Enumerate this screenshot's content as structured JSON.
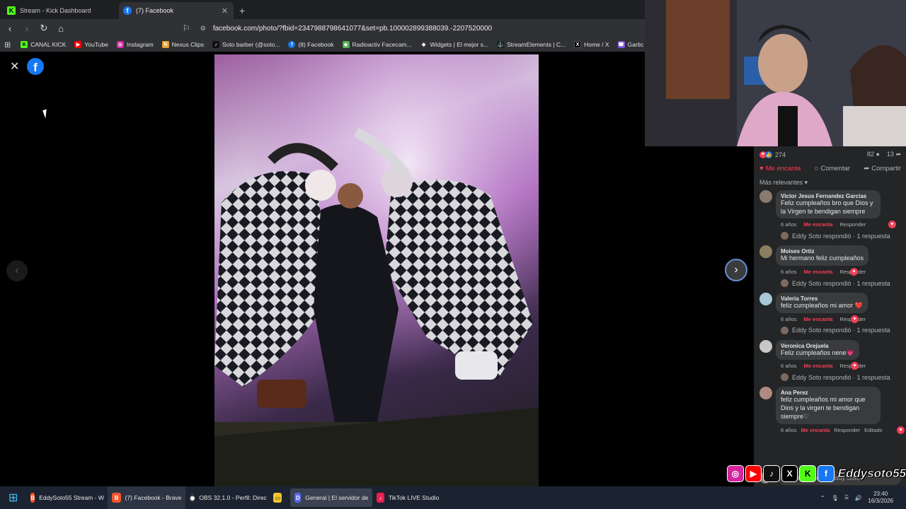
{
  "tabs": [
    {
      "title": "Stream - Kick Dashboard",
      "favicon": "K",
      "color": "#53fc18"
    },
    {
      "title": "(7) Facebook",
      "favicon": "f",
      "color": "#1877f2"
    }
  ],
  "new_tab": "+",
  "url": "facebook.com/photo/?fbid=2347988798641077&set=pb.100002899388039.-2207520000",
  "bookmarks": [
    {
      "label": "CANAL KICK",
      "icon": "K",
      "color": "#53fc18"
    },
    {
      "label": "YouTube",
      "icon": "▶",
      "color": "#ff0000"
    },
    {
      "label": "Instagram",
      "icon": "◎",
      "color": "#d6249f"
    },
    {
      "label": "Nexus Clips",
      "icon": "N",
      "color": "#e8a32e"
    },
    {
      "label": "Soto barber (@soto...",
      "icon": "♪",
      "color": "#111"
    },
    {
      "label": "(8) Facebook",
      "icon": "f",
      "color": "#1877f2"
    },
    {
      "label": "Radioactiv Facecam...",
      "icon": "◆",
      "color": "#4caf50"
    },
    {
      "label": "Widgets | El mejor s...",
      "icon": "◆",
      "color": "#333"
    },
    {
      "label": "StreamElements | C...",
      "icon": "⚓",
      "color": "#222"
    },
    {
      "label": "Home / X",
      "icon": "X",
      "color": "#000"
    },
    {
      "label": "Gartic Phone - Tele",
      "icon": "☎",
      "color": "#7b4fd8"
    }
  ],
  "post": {
    "reaction_count": "274",
    "comment_count": "82",
    "share_count": "13",
    "actions": {
      "love": "Me encanta",
      "comment": "Comentar",
      "share": "Compartir"
    },
    "sort_label": "Más relevantes"
  },
  "comments": [
    {
      "name": "Victor Jesus Fernandez Garcias",
      "text": "Feliz cumpleaños bro que Dios y la Virgen te bendigan siempre",
      "age": "6 años",
      "love": "Me encanta",
      "reply": "Responder",
      "replies": "Eddy Soto respondió · 1 respuesta"
    },
    {
      "name": "Moises Ortiz",
      "text": "Mi hermano feliz cumpleaños",
      "age": "6 años",
      "love": "Me encanta",
      "reply": "Responder",
      "replies": "Eddy Soto respondió · 1 respuesta"
    },
    {
      "name": "Valeria Torres",
      "text": "feliz cumpleaños mi amor ❤️",
      "age": "6 años",
      "love": "Me encanta",
      "reply": "Responder",
      "replies": "Eddy Soto respondió · 1 respuesta"
    },
    {
      "name": "Veronica Orejuela",
      "text": "Feliz cumpleaños nene💗",
      "age": "6 años",
      "love": "Me encanta",
      "reply": "Responder",
      "replies": "Eddy Soto respondió · 1 respuesta"
    },
    {
      "name": "Ana Perez",
      "text": "feliz cumpleaños mi amor que Dios y la virgen te bendigan siempre♡",
      "age": "6 años",
      "love": "Me encanta",
      "reply": "Responder",
      "edited": "Editado"
    }
  ],
  "compose_placeholder": "Comentar como Eddy Soto",
  "overlay_name": "Eddysoto55",
  "taskbar": [
    {
      "label": "EddySoto55 Stream - W",
      "icon": "B",
      "color": "#fb542b"
    },
    {
      "label": "(7) Facebook - Brave",
      "icon": "B",
      "color": "#fb542b"
    },
    {
      "label": "OBS 32.1.0 - Perfil: Direc",
      "icon": "◉",
      "color": "#302e31"
    },
    {
      "label": "",
      "icon": "▭",
      "color": "#f4c430"
    },
    {
      "label": "General | El servidor de",
      "icon": "D",
      "color": "#5865f2"
    },
    {
      "label": "TikTok LIVE Studio",
      "icon": "♪",
      "color": "#ee1d52"
    }
  ],
  "clock": {
    "time": "23:40",
    "date": "16/3/2026"
  }
}
